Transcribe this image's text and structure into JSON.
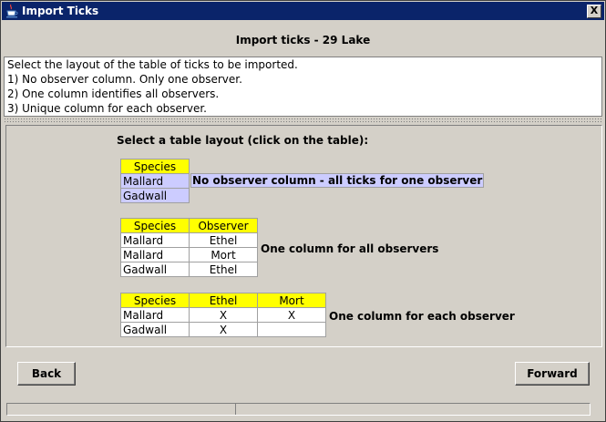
{
  "window": {
    "title": "Import Ticks",
    "close_label": "X"
  },
  "heading": "Import ticks - 29 Lake",
  "instructions": [
    "Select the layout of the table of ticks to be imported.",
    "1) No observer column. Only one observer.",
    "2) One column identifies all observers.",
    "3) Unique column for each observer."
  ],
  "panel": {
    "prompt": "Select a table layout (click on the table):",
    "layouts": [
      {
        "headers": [
          "Species"
        ],
        "rows": [
          [
            "Mallard"
          ],
          [
            "Gadwall"
          ]
        ],
        "label": "No observer column -  all ticks for one observer"
      },
      {
        "headers": [
          "Species",
          "Observer"
        ],
        "rows": [
          [
            "Mallard",
            "Ethel"
          ],
          [
            "Mallard",
            "Mort"
          ],
          [
            "Gadwall",
            "Ethel"
          ]
        ],
        "label": "One column for all observers"
      },
      {
        "headers": [
          "Species",
          "Ethel",
          "Mort"
        ],
        "rows": [
          [
            "Mallard",
            "X",
            "X"
          ],
          [
            "Gadwall",
            "X",
            ""
          ]
        ],
        "label": "One column for each observer"
      }
    ]
  },
  "buttons": {
    "back": "Back",
    "forward": "Forward"
  },
  "colors": {
    "header_fill": "#ffff00",
    "selected_fill": "#ccccff",
    "titlebar": "#0a246a"
  }
}
